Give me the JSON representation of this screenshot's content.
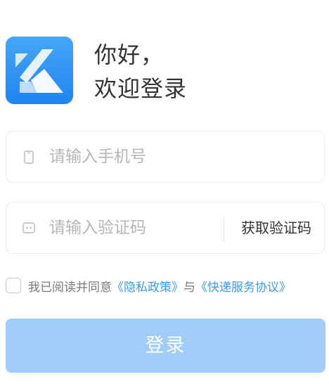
{
  "colors": {
    "brand": "#2a8ff2",
    "link": "#3b9cf0",
    "login_button_bg": "#a2cbf8",
    "placeholder": "#b6b6b6"
  },
  "header": {
    "logo_icon": "k-logo-icon",
    "greeting_line1": "你好，",
    "greeting_line2": "欢迎登录"
  },
  "form": {
    "phone": {
      "icon": "phone-icon",
      "placeholder": "请输入手机号",
      "value": ""
    },
    "code": {
      "icon": "message-icon",
      "placeholder": "请输入验证码",
      "value": "",
      "get_code_label": "获取验证码"
    }
  },
  "agreement": {
    "checked": false,
    "prefix": "我已阅读并同意",
    "privacy_link": "《隐私政策》",
    "joiner": "与",
    "service_link": "《快递服务协议》"
  },
  "login": {
    "label": "登录"
  }
}
